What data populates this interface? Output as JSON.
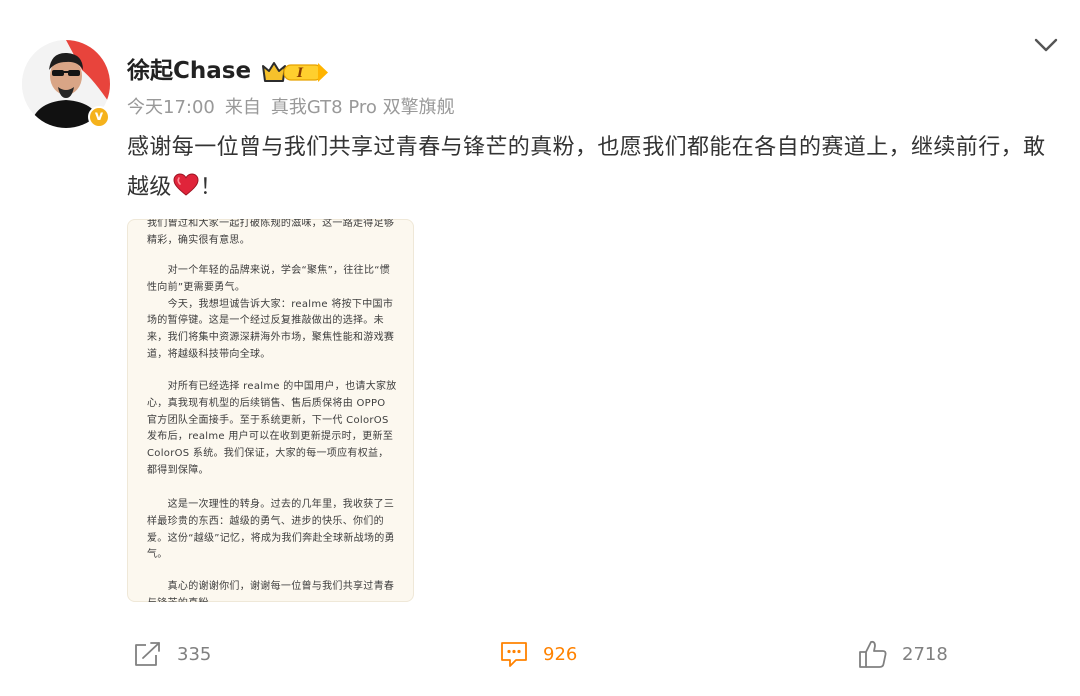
{
  "post": {
    "author": "徐起Chase",
    "vip_level": "I",
    "meta": {
      "time": "今天17:00",
      "source_prefix": "来自",
      "device": "真我GT8 Pro 双擎旗舰"
    },
    "text_part1": "感谢每一位曾与我们共享过青春与锋芒的真粉，也愿我们都能在各自的赛道上，继续前行，敢越级",
    "text_part2": "！",
    "image_text": {
      "p1": "我们曾过和大家一起打破陈规的滋味，这一路走得足够精彩，确实很有意思。",
      "p2": "　　对一个年轻的品牌来说，学会“聚焦”，往往比“惯性向前”更需要勇气。\n　　今天，我想坦诚告诉大家：realme 将按下中国市场的暂停键。这是一个经过反复推敲做出的选择。未来，我们将集中资源深耕海外市场，聚焦性能和游戏赛道，将越级科技带向全球。",
      "p3": "　　对所有已经选择 realme 的中国用户，也请大家放心，真我现有机型的后续销售、售后质保将由 OPPO 官方团队全面接手。至于系统更新，下一代 ColorOS 发布后，realme 用户可以在收到更新提示时，更新至 ColorOS 系统。我们保证，大家的每一项应有权益，都得到保障。",
      "p4": "　　这是一次理性的转身。过去的几年里，我收获了三样最珍贵的东西：越级的勇气、进步的快乐、你们的爱。这份“越级”记忆，将成为我们奔赴全球新战场的勇气。",
      "p5": "　　真心的谢谢你们，谢谢每一位曾与我们共享过青春与锋芒的真粉"
    }
  },
  "actions": {
    "repost_count": "335",
    "comment_count": "926",
    "like_count": "2718"
  },
  "colors": {
    "accent": "#ff8200",
    "muted": "#999999",
    "heart": "#e0243a",
    "badge": "#f5b21c"
  },
  "icons": [
    "chevron-down-icon",
    "crown-icon",
    "repost-icon",
    "comment-icon",
    "like-icon",
    "heart-icon",
    "verified-icon"
  ]
}
